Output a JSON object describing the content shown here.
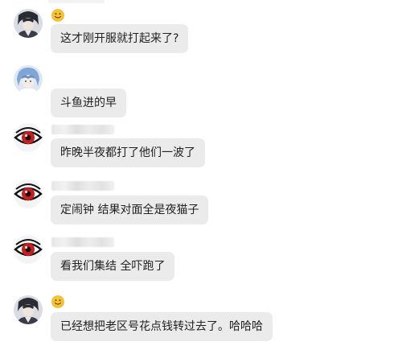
{
  "messages": [
    {
      "avatar": "person-dark-hair-avatar",
      "name_display": "emoji",
      "name_emoji": "smiley-face-icon",
      "text": "这才刚开服就打起来了?"
    },
    {
      "avatar": "anime-blue-hair-avatar",
      "name_display": "none",
      "text": "斗鱼进的早"
    },
    {
      "avatar": "red-eye-avatar",
      "name_display": "blurred",
      "text": "昨晚半夜都打了他们一波了"
    },
    {
      "avatar": "red-eye-avatar",
      "name_display": "blurred",
      "text": "定闹钟 结果对面全是夜猫子"
    },
    {
      "avatar": "red-eye-avatar",
      "name_display": "blurred",
      "text": "看我们集结 全吓跑了"
    },
    {
      "avatar": "person-dark-hair-avatar",
      "name_display": "emoji",
      "name_emoji": "smiley-face-icon",
      "text": "已经想把老区号花点钱转过去了。哈哈哈"
    }
  ],
  "colors": {
    "bubble_bg": "#ebebeb",
    "text": "#222222",
    "emoji_face": "#f6c431",
    "red_eye": "#c81e1e"
  }
}
